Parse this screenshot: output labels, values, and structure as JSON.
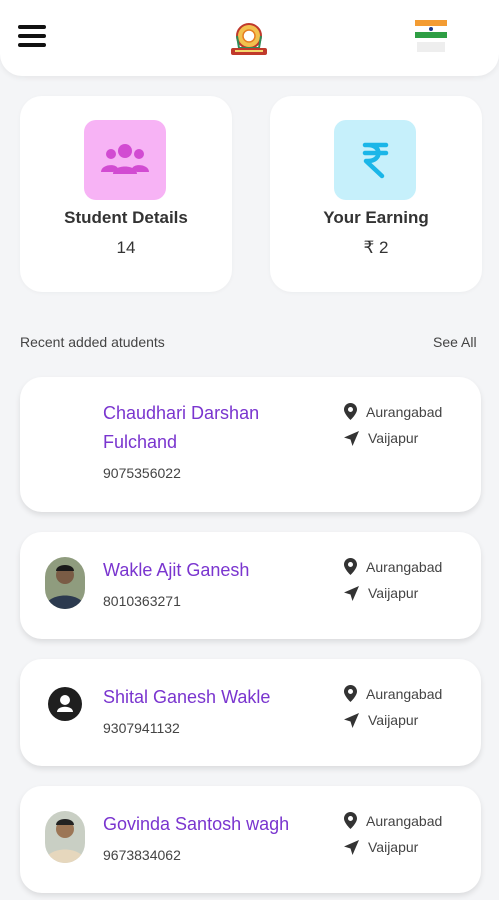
{
  "header": {
    "menu_icon": "hamburger-menu-icon",
    "logo_icon": "emblem-logo-icon",
    "flag_icon": "tricolor-flag-icon"
  },
  "stats": [
    {
      "title": "Student Details",
      "value": "14",
      "icon": "users-group-icon",
      "tint": "#f7b3f5",
      "icon_color": "#d24bd2"
    },
    {
      "title": "Your Earning",
      "value": "₹ 2",
      "icon": "rupee-icon",
      "tint": "#c6f0fb",
      "icon_color": "#1bb6e8"
    }
  ],
  "recent": {
    "title": "Recent added atudents",
    "see_all": "See All"
  },
  "students": [
    {
      "name_line1": "Chaudhari Darshan",
      "name_line2": "Fulchand",
      "phone": "9075356022",
      "district": "Aurangabad",
      "taluka": "Vaijapur",
      "avatar": "none"
    },
    {
      "name_line1": "Wakle Ajit Ganesh",
      "phone": "8010363271",
      "district": "Aurangabad",
      "taluka": "Vaijapur",
      "avatar": "photo"
    },
    {
      "name_line1": "Shital Ganesh Wakle",
      "phone": "9307941132",
      "district": "Aurangabad",
      "taluka": "Vaijapur",
      "avatar": "generic-user-icon"
    },
    {
      "name_line1": "Govinda Santosh wagh",
      "phone": "9673834062",
      "district": "Aurangabad",
      "taluka": "Vaijapur",
      "avatar": "photo"
    }
  ],
  "colors": {
    "accent_name": "#7a35cf",
    "background": "#f4f5f7"
  }
}
